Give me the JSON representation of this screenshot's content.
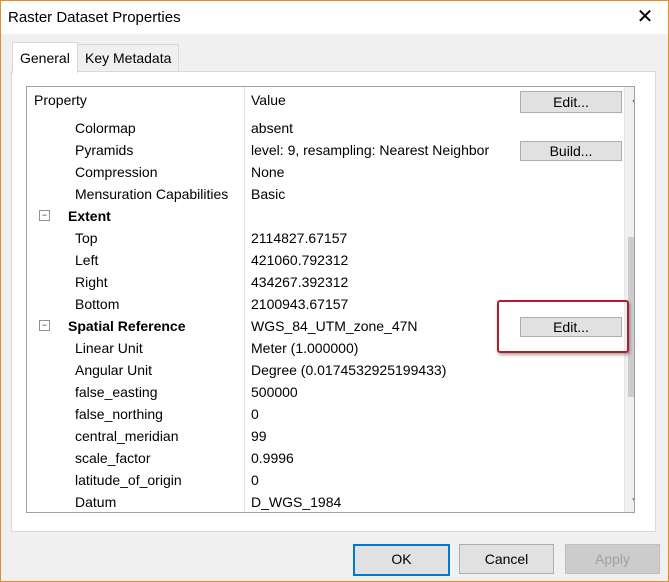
{
  "window": {
    "title": "Raster Dataset Properties"
  },
  "tabs": [
    {
      "label": "General",
      "active": true
    },
    {
      "label": "Key Metadata",
      "active": false
    }
  ],
  "grid": {
    "header": {
      "property": "Property",
      "value": "Value",
      "button": "Edit..."
    },
    "rows": [
      {
        "property": "Colormap",
        "value": "absent"
      },
      {
        "property": "Pyramids",
        "value": "level: 9, resampling: Nearest Neighbor",
        "button": "Build..."
      },
      {
        "property": "Compression",
        "value": "None"
      },
      {
        "property": "Mensuration Capabilities",
        "value": "Basic"
      },
      {
        "property": "Extent",
        "value": "",
        "group": true,
        "expander": "−"
      },
      {
        "property": "Top",
        "value": "2114827.67157"
      },
      {
        "property": "Left",
        "value": "421060.792312"
      },
      {
        "property": "Right",
        "value": "434267.392312"
      },
      {
        "property": "Bottom",
        "value": "2100943.67157"
      },
      {
        "property": "Spatial Reference",
        "value": "WGS_84_UTM_zone_47N",
        "group": true,
        "expander": "−",
        "button": "Edit..."
      },
      {
        "property": "Linear Unit",
        "value": "Meter (1.000000)"
      },
      {
        "property": "Angular Unit",
        "value": "Degree (0.0174532925199433)"
      },
      {
        "property": "false_easting",
        "value": "500000"
      },
      {
        "property": "false_northing",
        "value": "0"
      },
      {
        "property": "central_meridian",
        "value": "99"
      },
      {
        "property": "scale_factor",
        "value": "0.9996"
      },
      {
        "property": "latitude_of_origin",
        "value": "0"
      },
      {
        "property": "Datum",
        "value": "D_WGS_1984"
      }
    ]
  },
  "buttons": {
    "ok": "OK",
    "cancel": "Cancel",
    "apply": "Apply"
  },
  "icons": {
    "close": "close-icon",
    "scroll_up": "chevron-up-icon",
    "scroll_down": "chevron-down-icon",
    "collapse": "minus-box-icon"
  },
  "colors": {
    "highlight": "#b01e2e",
    "default_button_border": "#0078d7",
    "window_border": "#e08e2a"
  }
}
